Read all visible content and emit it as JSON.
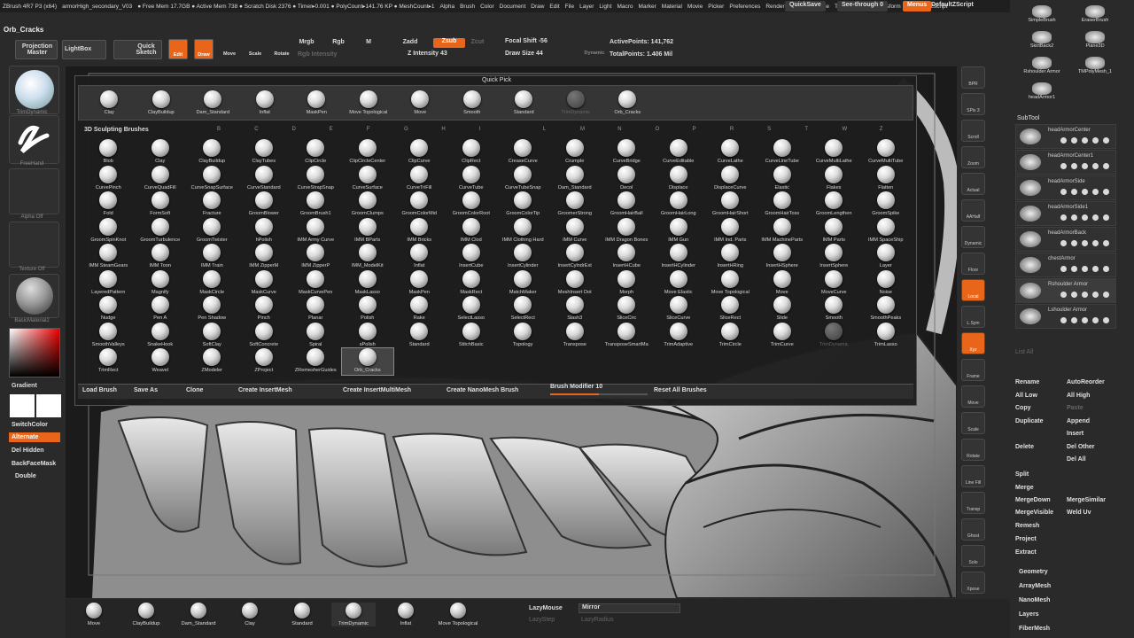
{
  "menubar": {
    "items": [
      "ZBrush 4R7 P3 (x64)",
      "armorHigh_secondary_V03",
      "● Free Mem 17.7GB ● Active Mem 738 ● Scratch Disk 2376 ● Timer▸0.001 ● PolyCount▸141.76 KP ● MeshCount▸1",
      "Alpha",
      "Brush",
      "Color",
      "Document",
      "Draw",
      "Edit",
      "File",
      "Layer",
      "Light",
      "Macro",
      "Marker",
      "Material",
      "Movie",
      "Picker",
      "Preferences",
      "Render",
      "Stencil",
      "Stroke",
      "Texture",
      "Tool",
      "Transform",
      "Zplugin",
      "Zscript"
    ],
    "quicksave": "QuickSave",
    "seethrough": "See-through  0",
    "menus": "Menus",
    "script": "DefaultZScript"
  },
  "doc_title": "Orb_Cracks",
  "toolbar": {
    "projection": "Projection Master",
    "lightbox": "LightBox",
    "quicksketch": "Quick Sketch",
    "edit": "Edit",
    "draw": "Draw",
    "move": "Move",
    "scale": "Scale",
    "rotate": "Rotate",
    "mrgb": "Mrgb",
    "rgb": "Rgb",
    "m": "M",
    "rgb_intensity": "Rgb Intensity",
    "zadd": "Zadd",
    "zsub": "Zsub",
    "zcut": "Zcut",
    "z_intensity": "Z Intensity 43",
    "focal": "Focal Shift -56",
    "draw_size": "Draw Size 44",
    "dynamic": "Dynamic",
    "active_points": "ActivePoints: 141,762",
    "total_points": "TotalPoints: 1.406 Mil"
  },
  "left": {
    "brush_label": "TrimDynamic",
    "stroke_label": "FreeHand",
    "alpha_label": "Alpha  Off",
    "texture_label": "Texture  Off",
    "material_label": "BasicMaterial2",
    "gradient": "Gradient",
    "switchcolor": "SwitchColor",
    "alternate": "Alternate",
    "del_hidden": "Del Hidden",
    "backfacemask": "BackFaceMask",
    "double": "Double"
  },
  "quickpick": {
    "title": "Quick Pick",
    "items": [
      "Clay",
      "ClayBuildup",
      "Dam_Standard",
      "Inflat",
      "MaskPen",
      "Move Topological",
      "Move",
      "Smooth",
      "Standard",
      "TrimDynamic",
      "Orb_Cracks"
    ]
  },
  "sculpt": {
    "title": "3D Sculpting Brushes",
    "letters": [
      "B",
      "C",
      "D",
      "E",
      "F",
      "G",
      "H",
      "I",
      "L",
      "M",
      "N",
      "O",
      "P",
      "R",
      "S",
      "T",
      "W",
      "Z"
    ],
    "items": [
      "Blob",
      "Clay",
      "ClayBuildup",
      "ClayTubes",
      "ClipCircle",
      "ClipCircleCenter",
      "ClipCurve",
      "ClipRect",
      "CreaseCurve",
      "Crumple",
      "CurveBridge",
      "CurveEditable",
      "CurveLathe",
      "CurveLineTube",
      "CurveMultiLathe",
      "CurveMultiTube",
      "CurvePinch",
      "CurveQuadFill",
      "CurveSnapSurface",
      "CurveStandard",
      "CurveStrapSnap",
      "CurveSurface",
      "CurveTriFill",
      "CurveTube",
      "CurveTubeSnap",
      "Dam_Standard",
      "Decol",
      "Displace",
      "DisplaceCurve",
      "Elastic",
      "Flakes",
      "Flatten",
      "Fold",
      "FormSoft",
      "Fracture",
      "GroomBlower",
      "GroomBrush1",
      "GroomClumps",
      "GroomColorMid",
      "GroomColorRoot",
      "GroomColorTip",
      "GroomerStrong",
      "GroomHairBall",
      "GroomHairLong",
      "GroomHairShort",
      "GroomHairToss",
      "GroomLengthen",
      "GroomSpike",
      "GroomSpinKnot",
      "GroomTurbulence",
      "GroomTwister",
      "hPolish",
      "IMM Army Curve",
      "IMM BParts",
      "IMM Bricks",
      "IMM Clod",
      "IMM Clothing Hard",
      "IMM Curve",
      "IMM Dragon Bones",
      "IMM Gun",
      "IMM Ind. Parts",
      "IMM MachineParts",
      "IMM Parts",
      "IMM SpaceShip",
      "IMM SteamGears",
      "IMM Toon",
      "IMM Train",
      "IMM ZipperM",
      "IMM ZipperP",
      "IMM_ModelKit",
      "Inflat",
      "InsertCube",
      "InsertCylinder",
      "InsertCylndrExt",
      "InsertHCube",
      "InsertHCylinder",
      "InsertHRing",
      "InsertHSphere",
      "InsertSphere",
      "Layer",
      "LayeredPattern",
      "Magnify",
      "MaskCircle",
      "MaskCurve",
      "MaskCurvePen",
      "MaskLasso",
      "MaskPen",
      "MaskRect",
      "MatchMaker",
      "MeshInsert Dot",
      "Morph",
      "Move Elastic",
      "Move Topological",
      "Move",
      "MoveCurve",
      "Noise",
      "Nudge",
      "Pen A",
      "Pen Shadow",
      "Pinch",
      "Planar",
      "Polish",
      "Rake",
      "SelectLasso",
      "SelectRect",
      "Slash3",
      "SliceCirc",
      "SliceCurve",
      "SliceRect",
      "Slide",
      "Smooth",
      "SmoothPeaks",
      "SmoothValleys",
      "SnakeHook",
      "SoftClay",
      "SoftConcrete",
      "Spiral",
      "sPolish",
      "Standard",
      "StitchBasic",
      "Topology",
      "Transpose",
      "TransposeSmartMa",
      "TrimAdaptive",
      "TrimCircle",
      "TrimCurve",
      "TrimDynamic",
      "TrimLasso",
      "TrimRect",
      "Weavel",
      "ZModeler",
      "ZProject",
      "ZRemesherGuides",
      "Orb_Cracks"
    ]
  },
  "popup_buttons": {
    "load": "Load Brush",
    "save": "Save As",
    "clone": "Clone",
    "insertmesh": "Create InsertMesh",
    "insertmulti": "Create InsertMultiMesh",
    "nanomesh": "Create NanoMesh Brush",
    "modifier": "Brush Modifier 10",
    "reset": "Reset All Brushes"
  },
  "shelf": [
    "BPR",
    "SPix 3",
    "Scroll",
    "Zoom",
    "Actual",
    "AAHalf",
    "Dynamic Persp",
    "Floor",
    "Local",
    "L.Sym",
    "Xyz",
    "Frame",
    "Move",
    "Scale",
    "Rotate",
    "Line Fill PolyF",
    "Transp",
    "Ghost",
    "Solo",
    "Xpose"
  ],
  "right": {
    "top_items": [
      "SimpleBrush",
      "EraserBrush",
      "SkirtBack2",
      "Plane3D",
      "Rshoulder Armor",
      "TMPolyMesh_1",
      "headArmor1"
    ],
    "subtool_title": "SubTool",
    "subtools": [
      "headArmorCenter",
      "headArmorCenter1",
      "headArmorSide",
      "headArmorSide1",
      "headArmorBack",
      "chestArmor",
      "Rshoulder Armor",
      "Lshoulder Armor"
    ],
    "list_all": "List All",
    "ops": [
      [
        "Rename",
        "AutoReorder"
      ],
      [
        "All Low",
        "All High"
      ],
      [
        "Copy",
        "Paste"
      ],
      [
        "Duplicate",
        "Append"
      ],
      [
        "",
        "Insert"
      ],
      [
        "Delete",
        "Del Other"
      ],
      [
        "",
        "Del All"
      ]
    ],
    "ops2": [
      "Split",
      "Merge"
    ],
    "merge_ops": [
      [
        "MergeDown",
        "MergeSimilar"
      ],
      [
        "MergeVisible",
        "Weld  Uv"
      ]
    ],
    "ops3": [
      "Remesh",
      "Project",
      "Extract"
    ],
    "sections": [
      "Geometry",
      "ArrayMesh",
      "NanoMesh",
      "Layers",
      "FiberMesh"
    ]
  },
  "bottom": {
    "items": [
      "Move",
      "ClayBuildup",
      "Dam_Standard",
      "Clay",
      "Standard",
      "TrimDynamic",
      "Inflat",
      "Move Topological"
    ],
    "lazymouse": "LazyMouse",
    "lazystep": "LazyStep",
    "mirror": "Mirror",
    "lazyradius": "LazyRadius"
  }
}
